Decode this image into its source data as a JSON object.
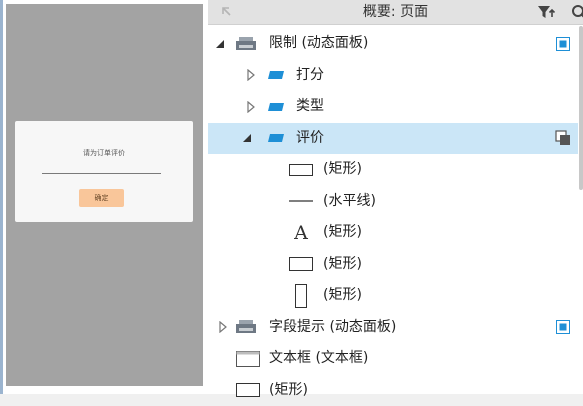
{
  "canvas": {
    "dialog_text": "请为订单评价",
    "dialog_button": "确定"
  },
  "panel": {
    "title": "概要: 页面"
  },
  "outline": [
    {
      "label": "限制 (动态面板)",
      "icon": "dynamic-panel-icon",
      "toggle": "expanded"
    },
    {
      "label": "打分",
      "icon": "state-icon",
      "toggle": "collapsed"
    },
    {
      "label": "类型",
      "icon": "state-icon",
      "toggle": "collapsed"
    },
    {
      "label": "评价",
      "icon": "state-icon",
      "toggle": "expanded",
      "selected": true
    },
    {
      "label": "(矩形)",
      "icon": "rectangle-icon"
    },
    {
      "label": "(水平线)",
      "icon": "horizontal-line-icon"
    },
    {
      "label": "(矩形)",
      "icon": "text-label-icon"
    },
    {
      "label": "(矩形)",
      "icon": "rectangle-icon"
    },
    {
      "label": "(矩形)",
      "icon": "vertical-rectangle-icon"
    },
    {
      "label": "字段提示 (动态面板)",
      "icon": "dynamic-panel-icon",
      "toggle": "collapsed"
    },
    {
      "label": "文本框 (文本框)",
      "icon": "textbox-icon"
    },
    {
      "label": "(矩形)",
      "icon": "rectangle-icon"
    }
  ],
  "colors": {
    "selected_row": "#cbe6f7",
    "accent_blue": "#1e8fd6",
    "dialog_button": "#f9c69a",
    "canvas_device": "#a3a3a3"
  }
}
